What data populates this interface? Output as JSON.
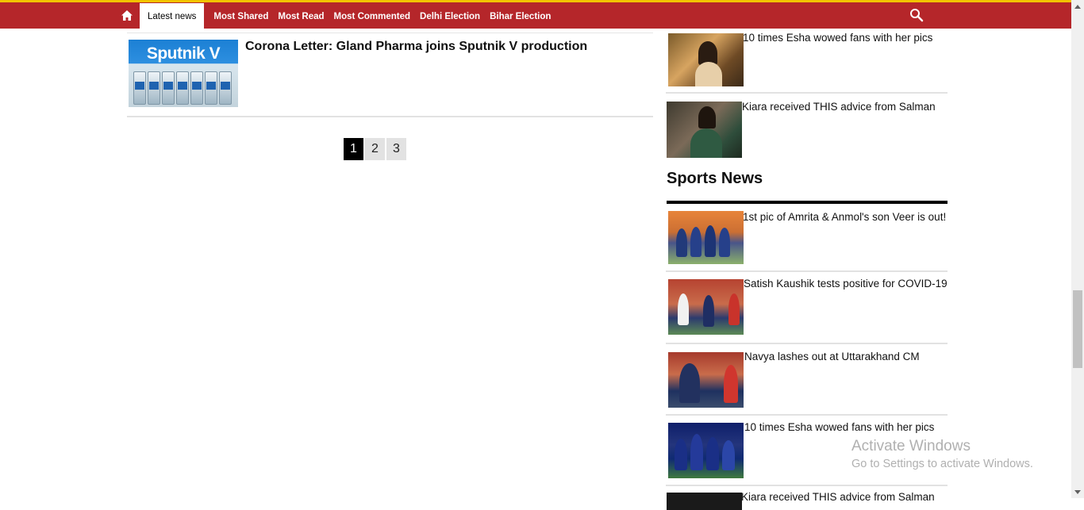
{
  "nav": {
    "home_icon": "home-icon",
    "items": [
      {
        "label": "Latest news",
        "active": true
      },
      {
        "label": "Most Shared",
        "active": false
      },
      {
        "label": "Most Read",
        "active": false
      },
      {
        "label": "Most Commented",
        "active": false
      },
      {
        "label": "Delhi Election",
        "active": false
      },
      {
        "label": "Bihar Election",
        "active": false
      }
    ],
    "search_icon": "search-icon",
    "colors": {
      "bar": "#b5262a",
      "accent_line": "#f2c300"
    }
  },
  "main_story": {
    "thumb_logo": "Sputnik V",
    "title": "Corona Letter: Gland Pharma joins Sputnik V production"
  },
  "pagination": {
    "pages": [
      "1",
      "2",
      "3"
    ],
    "current": "1"
  },
  "sidebar": {
    "top_items": [
      {
        "title": "10 times Esha wowed fans with her pics"
      },
      {
        "title": "Kiara received THIS advice from Salman"
      }
    ],
    "sports_heading": "Sports News",
    "sports_items": [
      {
        "title": "1st pic of Amrita & Anmol's son Veer is out!"
      },
      {
        "title": "Satish Kaushik tests positive for COVID-19"
      },
      {
        "title": "Navya lashes out at Uttarakhand CM"
      },
      {
        "title": "10 times Esha wowed fans with her pics"
      },
      {
        "title": "Kiara received THIS advice from Salman"
      }
    ]
  },
  "watermark": {
    "line1": "Activate Windows",
    "line2": "Go to Settings to activate Windows."
  }
}
